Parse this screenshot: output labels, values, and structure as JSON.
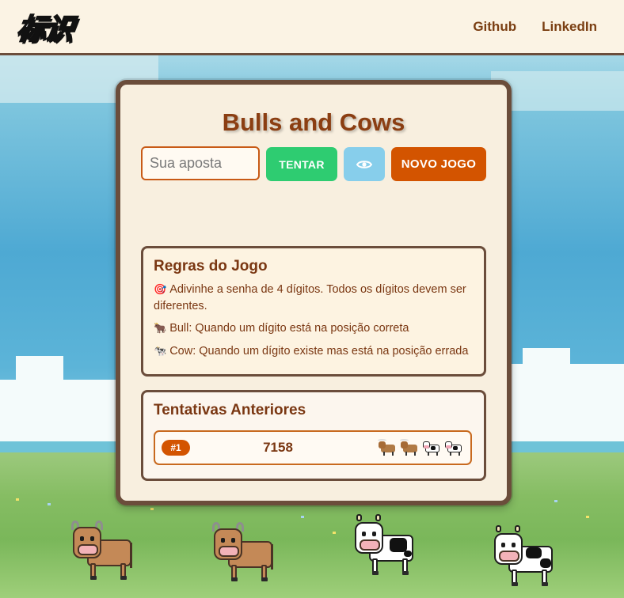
{
  "header": {
    "logo_text": "标识",
    "nav": [
      {
        "label": "Github"
      },
      {
        "label": "LinkedIn"
      }
    ]
  },
  "game": {
    "title": "Bulls and Cows",
    "input_placeholder": "Sua aposta",
    "input_value": "",
    "try_label": "TENTAR",
    "reveal_icon": "eye-icon",
    "new_game_label": "NOVO JOGO"
  },
  "rules": {
    "title": "Regras do Jogo",
    "items": [
      {
        "icon": "🎯",
        "text": "Adivinhe a senha de 4 dígitos. Todos os dígitos devem ser diferentes."
      },
      {
        "icon": "🐂",
        "text": "Bull: Quando um dígito está na posição correta"
      },
      {
        "icon": "🐄",
        "text": "Cow: Quando um dígito existe mas está na posição errada"
      }
    ]
  },
  "history": {
    "title": "Tentativas Anteriores",
    "attempts": [
      {
        "number": "#1",
        "guess": "7158",
        "bulls": 2,
        "cows": 2
      }
    ]
  },
  "colors": {
    "accent_orange": "#d35400",
    "try_green": "#2ecc71",
    "reveal_blue": "#87ceeb",
    "text_brown": "#7a3712",
    "border_brown": "#6b4d3b"
  },
  "scene": {
    "animals": [
      "bull",
      "bull",
      "cow",
      "cow"
    ]
  }
}
